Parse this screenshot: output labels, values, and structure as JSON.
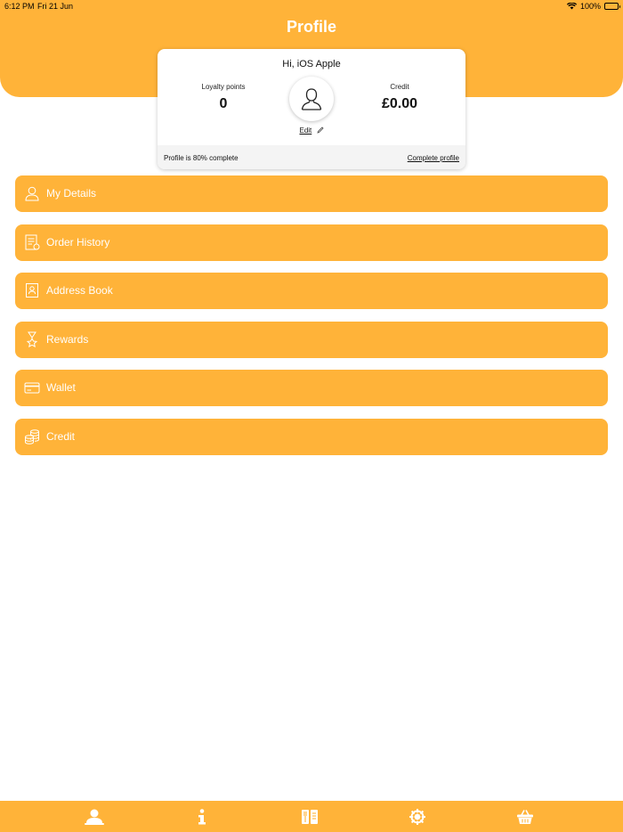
{
  "status_bar": {
    "time": "6:12 PM",
    "date": "Fri 21 Jun",
    "battery": "100%"
  },
  "header": {
    "title": "Profile"
  },
  "card": {
    "greeting": "Hi, iOS Apple",
    "loyalty_label": "Loyalty points",
    "loyalty_value": "0",
    "credit_label": "Credit",
    "credit_value": "£0.00",
    "edit_label": "Edit",
    "progress_text": "Profile is 80% complete",
    "complete_link": "Complete profile"
  },
  "menu": {
    "items": [
      {
        "label": "My Details",
        "icon": "person-icon"
      },
      {
        "label": "Order History",
        "icon": "receipt-icon"
      },
      {
        "label": "Address Book",
        "icon": "address-book-icon"
      },
      {
        "label": "Rewards",
        "icon": "medal-icon"
      },
      {
        "label": "Wallet",
        "icon": "card-icon"
      },
      {
        "label": "Credit",
        "icon": "coins-icon"
      }
    ]
  },
  "tab_bar": {
    "tabs": [
      "profile-tab",
      "info-tab",
      "menu-tab",
      "settings-tab",
      "basket-tab"
    ],
    "active": "profile-tab"
  },
  "colors": {
    "accent": "#FFB339",
    "text": "#111111",
    "card_footer": "#f4f4f4"
  }
}
